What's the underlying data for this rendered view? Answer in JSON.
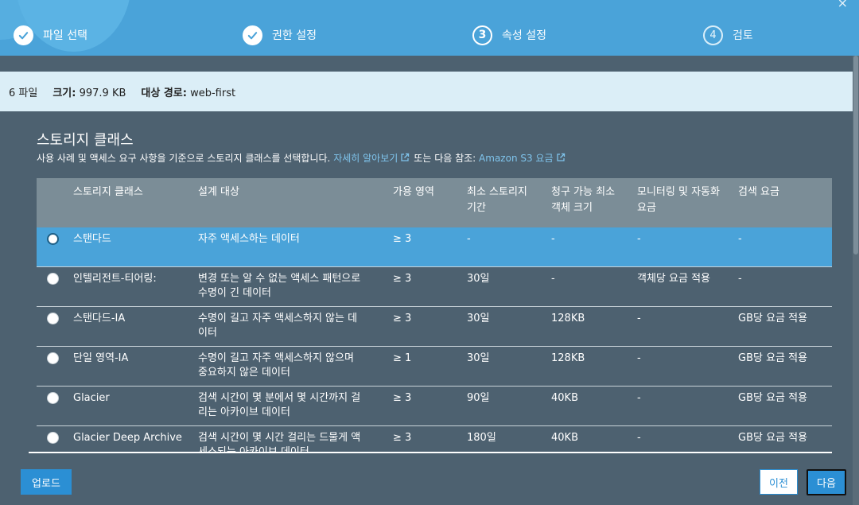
{
  "wizard": {
    "steps": [
      {
        "number": "",
        "label": "파일 선택",
        "state": "done"
      },
      {
        "number": "",
        "label": "권한 설정",
        "state": "done"
      },
      {
        "number": "3",
        "label": "속성 설정",
        "state": "current"
      },
      {
        "number": "4",
        "label": "검토",
        "state": "future"
      }
    ],
    "close_icon": "×"
  },
  "infobar": {
    "files": "6 파일",
    "size_label": "크기:",
    "size_value": "997.9 KB",
    "path_label": "대상 경로:",
    "path_value": "web-first"
  },
  "storage": {
    "title": "스토리지 클래스",
    "description": "사용 사례 및 액세스 요구 사항을 기준으로 스토리지 클래스를 선택합니다.",
    "learn_more": "자세히 알아보기",
    "also_see": "또는 다음 참조:",
    "pricing_link": "Amazon S3 요금"
  },
  "table": {
    "headers": {
      "class": "스토리지 클래스",
      "designed_for": "설계 대상",
      "az_line1": "가용 영역",
      "min_duration_line1": "최소 스토리지",
      "min_duration_line2": "기간",
      "min_size_line1": "청구 가능 최소",
      "min_size_line2": "객체 크기",
      "monitoring_line1": "모니터링 및 자동화",
      "monitoring_line2": "요금",
      "retrieval": "검색 요금"
    },
    "rows": [
      {
        "name": "스탠다드",
        "designed1": "자주 액세스하는 데이터",
        "designed2": "",
        "az": "≥ 3",
        "min_duration": "-",
        "min_size": "-",
        "monitoring": "-",
        "retrieval": "-",
        "selected": true
      },
      {
        "name": "인텔리전트-티어링:",
        "designed1": "변경 또는 알 수 없는 액세스 패턴으로",
        "designed2": "수명이 긴 데이터",
        "az": "≥ 3",
        "min_duration": "30일",
        "min_size": "-",
        "monitoring": "객체당 요금 적용",
        "retrieval": "-",
        "selected": false
      },
      {
        "name": "스탠다드-IA",
        "designed1": "수명이 길고 자주 액세스하지 않는 데",
        "designed2": "이터",
        "az": "≥ 3",
        "min_duration": "30일",
        "min_size": "128KB",
        "monitoring": "-",
        "retrieval": "GB당 요금 적용",
        "selected": false
      },
      {
        "name": "단일 영역-IA",
        "designed1": "수명이 길고 자주 액세스하지 않으며",
        "designed2": "중요하지 않은 데이터",
        "az": "≥ 1",
        "min_duration": "30일",
        "min_size": "128KB",
        "monitoring": "-",
        "retrieval": "GB당 요금 적용",
        "selected": false
      },
      {
        "name": "Glacier",
        "designed1": "검색 시간이 몇 분에서 몇 시간까지 걸",
        "designed2": "리는 아카이브 데이터",
        "az": "≥ 3",
        "min_duration": "90일",
        "min_size": "40KB",
        "monitoring": "-",
        "retrieval": "GB당 요금 적용",
        "selected": false
      },
      {
        "name": "Glacier Deep Archive",
        "designed1": "검색 시간이 몇 시간 걸리는 드물게 액",
        "designed2": "세스되는 아카이브 데이터",
        "az": "≥ 3",
        "min_duration": "180일",
        "min_size": "40KB",
        "monitoring": "-",
        "retrieval": "GB당 요금 적용",
        "selected": false
      }
    ]
  },
  "footer": {
    "upload": "업로드",
    "prev": "이전",
    "next": "다음"
  },
  "colors": {
    "header_bg": "#4aa3d9",
    "body_bg": "#4d6170",
    "selected_row": "#4aa3d9",
    "table_header": "#7b8d97",
    "link": "#7fc4ec",
    "button": "#2b8fd4"
  }
}
